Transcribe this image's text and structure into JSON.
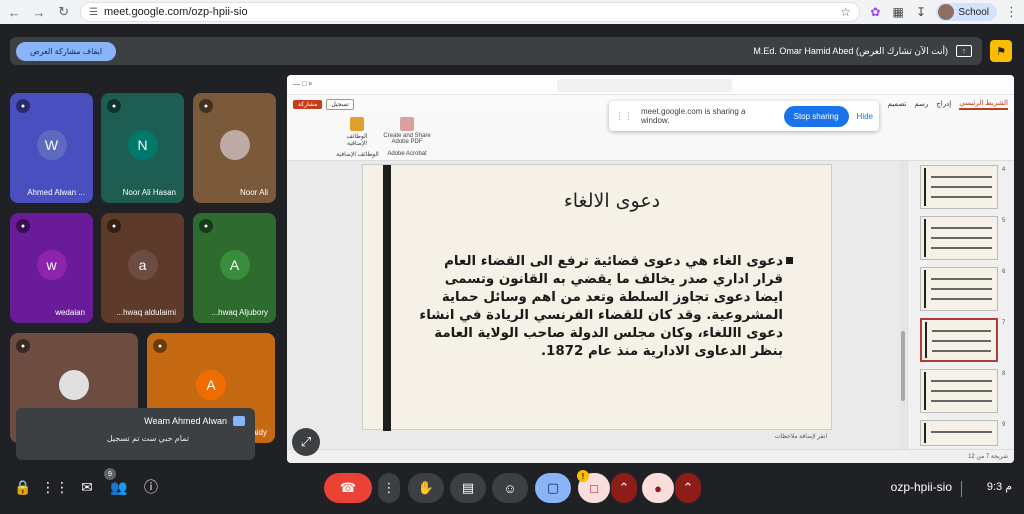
{
  "browser": {
    "url": "meet.google.com/ozp-hpii-sio",
    "profile_label": "School"
  },
  "banner": {
    "stop_sharing_label": "ايقاف مشاركة العرض",
    "presenter_text": "M.Ed. Omar Hamid Abed (أنت الآن تشارك العرض)"
  },
  "participants": [
    {
      "name": "Ahmed Alwan ...",
      "initial": "W",
      "bg": "#4a4fbf",
      "avatar_bg": "#5c6bc0"
    },
    {
      "name": "Noor Ali Hasan",
      "initial": "N",
      "bg": "#1e5e52",
      "avatar_bg": "#00796b"
    },
    {
      "name": "Noor Ali",
      "initial": "",
      "bg": "#7a5a3a",
      "avatar_bg": "#bcaaa4"
    },
    {
      "name": "wedaian",
      "initial": "w",
      "bg": "#6a1b9a",
      "avatar_bg": "#8e24aa"
    },
    {
      "name": "...hwaq aldulaimi",
      "initial": "a",
      "bg": "#5d3a2a",
      "avatar_bg": "#6d4c41"
    },
    {
      "name": "...hwaq Aljubory",
      "initial": "A",
      "bg": "#2e6b2e",
      "avatar_bg": "#388e3c"
    },
    {
      "name": "",
      "initial": "",
      "bg": "#6d4c41",
      "avatar_bg": "#e0e0e0"
    },
    {
      "name": "...aidy",
      "initial": "A",
      "bg": "#c56a12",
      "avatar_bg": "#ef6c00"
    }
  ],
  "toast": {
    "sender": "Weam Ahmed Alwan",
    "message": "تمام حبي ست تم تسجيل"
  },
  "ppt": {
    "record_label": "تسجيل",
    "share_label": "مشاركة",
    "tabs": [
      "الشريط الرئيسي",
      "إدراج",
      "رسم",
      "تصميم"
    ],
    "ribbon": {
      "adobe": "Create and Share Adobe PDF",
      "adobe_group": "Adobe Acrobat",
      "addins_group": "الوظائف الإضافية",
      "addins": "الوظائف الإضافية"
    },
    "notes_hint": "انقر لإضافة ملاحظات",
    "status": "شريحة 7 من 12"
  },
  "sharing_popup": {
    "message": "meet.google.com is sharing a window.",
    "stop_label": "Stop sharing",
    "hide_label": "Hide"
  },
  "slide": {
    "title": "دعوى الالغاء",
    "body": "دعوى الغاء هي دعوى قضائية ترفع الى القضاء العام قرار اداري صدر يخالف ما يقضي به القانون وتسمى ايضا دعوى تجاوز السلطة وتعد من اهم وسائل حماية المشروعية. وقد كان للقضاء الفرنسي الريادة في انشاء دعوى االلغاء، وكان مجلس الدولة صاحب الولاية العامة بنظر الدعاوى الادارية منذ عام 1872."
  },
  "thumbnails": [
    {
      "num": "4",
      "active": false
    },
    {
      "num": "5",
      "active": false
    },
    {
      "num": "6",
      "active": false
    },
    {
      "num": "7",
      "active": true
    },
    {
      "num": "8",
      "active": false
    },
    {
      "num": "9",
      "active": false
    }
  ],
  "bottom": {
    "people_count": "9",
    "meeting_code": "ozp-hpii-sio",
    "clock": "9:3 م",
    "warn": "!"
  }
}
